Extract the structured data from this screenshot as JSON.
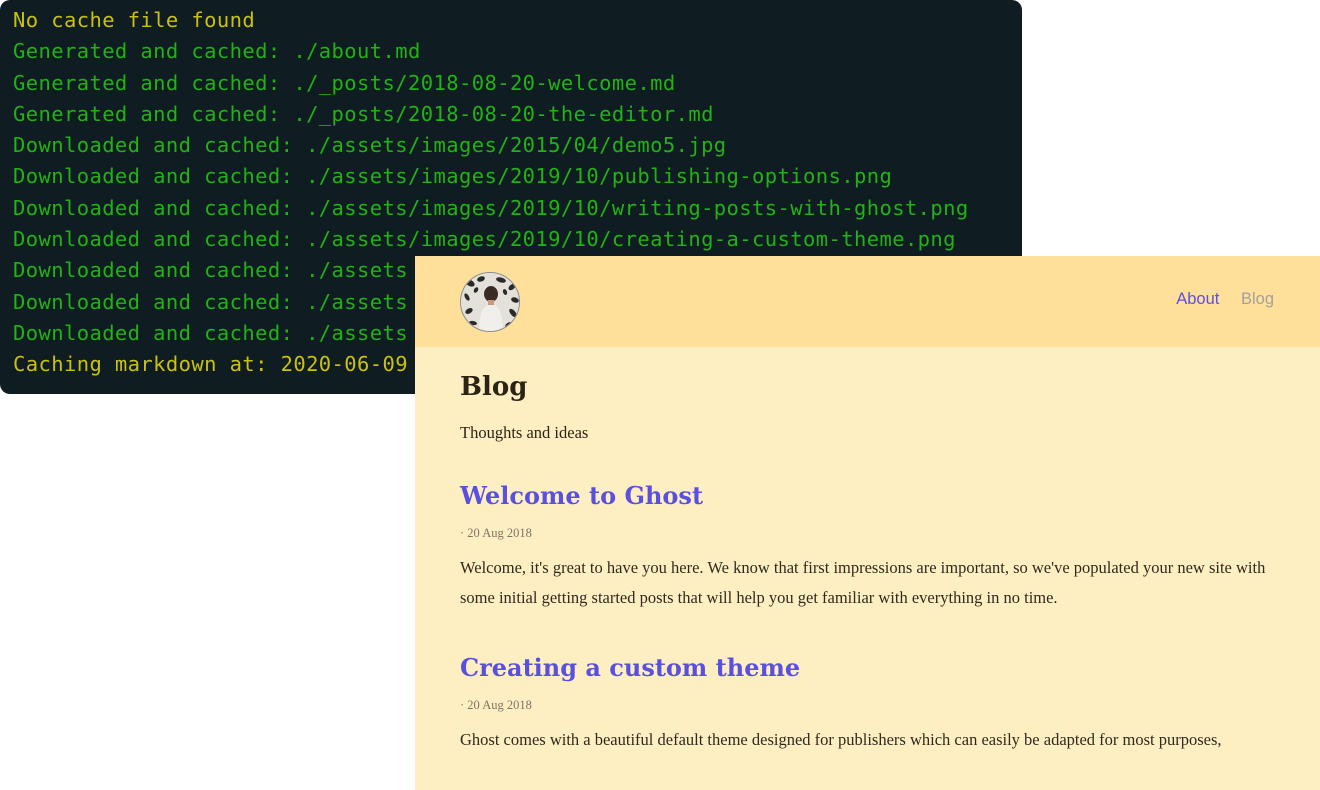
{
  "terminal": {
    "lines": [
      {
        "text": "No cache file found",
        "color": "#c8c20f"
      },
      {
        "text": "Generated and cached: ./about.md",
        "color": "#22b215"
      },
      {
        "text": "Generated and cached: ./_posts/2018-08-20-welcome.md",
        "color": "#22b215"
      },
      {
        "text": "Generated and cached: ./_posts/2018-08-20-the-editor.md",
        "color": "#22b215"
      },
      {
        "text": "Downloaded and cached: ./assets/images/2015/04/demo5.jpg",
        "color": "#22b215"
      },
      {
        "text": "Downloaded and cached: ./assets/images/2019/10/publishing-options.png",
        "color": "#22b215"
      },
      {
        "text": "Downloaded and cached: ./assets/images/2019/10/writing-posts-with-ghost.png",
        "color": "#22b215"
      },
      {
        "text": "Downloaded and cached: ./assets/images/2019/10/creating-a-custom-theme.png",
        "color": "#22b215"
      },
      {
        "text": "Downloaded and cached: ./assets",
        "color": "#22b215"
      },
      {
        "text": "Downloaded and cached: ./assets",
        "color": "#22b215"
      },
      {
        "text": "Downloaded and cached: ./assets",
        "color": "#22b215"
      },
      {
        "text": "Caching markdown at: 2020-06-09",
        "color": "#c8c20f"
      }
    ]
  },
  "blog": {
    "nav": {
      "about_label": "About",
      "blog_label": "Blog"
    },
    "avatar_icon": "profile-photo",
    "page_title": "Blog",
    "page_subtitle": "Thoughts and ideas",
    "posts": [
      {
        "title": "Welcome to Ghost",
        "date": "· 20 Aug 2018",
        "excerpt": "Welcome, it's great to have you here. We know that first impressions are important, so we've populated your new site with some initial getting started posts that will help you get familiar with everything in no time."
      },
      {
        "title": "Creating a custom theme",
        "date": "· 20 Aug 2018",
        "excerpt": "Ghost comes with a beautiful default theme designed for publishers which can easily be adapted for most purposes,"
      }
    ],
    "colors": {
      "header_bg": "#ffe09a",
      "page_bg": "#feefc3",
      "link": "#5a50e0"
    }
  }
}
